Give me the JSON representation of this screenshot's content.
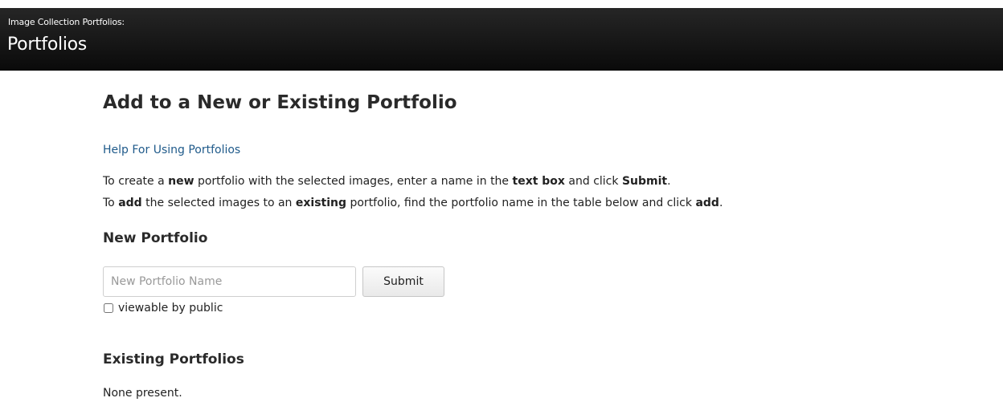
{
  "header": {
    "subtitle": "Image Collection Portfolios:",
    "title": "Portfolios"
  },
  "main": {
    "page_title": "Add to a New or Existing Portfolio",
    "help_link": "Help For Using Portfolios",
    "instructions": {
      "line1": {
        "t1": "To create a ",
        "b1": "new",
        "t2": " portfolio with the selected images, enter a name in the ",
        "b2": "text box",
        "t3": " and click ",
        "b3": "Submit",
        "t4": "."
      },
      "line2": {
        "t1": "To ",
        "b1": "add",
        "t2": " the selected images to an ",
        "b2": "existing",
        "t3": " portfolio, find the portfolio name in the table below and click ",
        "b3": "add",
        "t4": "."
      }
    },
    "new_portfolio": {
      "heading": "New Portfolio",
      "input_placeholder": "New Portfolio Name",
      "input_value": "",
      "submit_label": "Submit",
      "public_label": "viewable by public",
      "public_checked": false
    },
    "existing_portfolios": {
      "heading": "Existing Portfolios",
      "empty_text": "None present."
    }
  }
}
